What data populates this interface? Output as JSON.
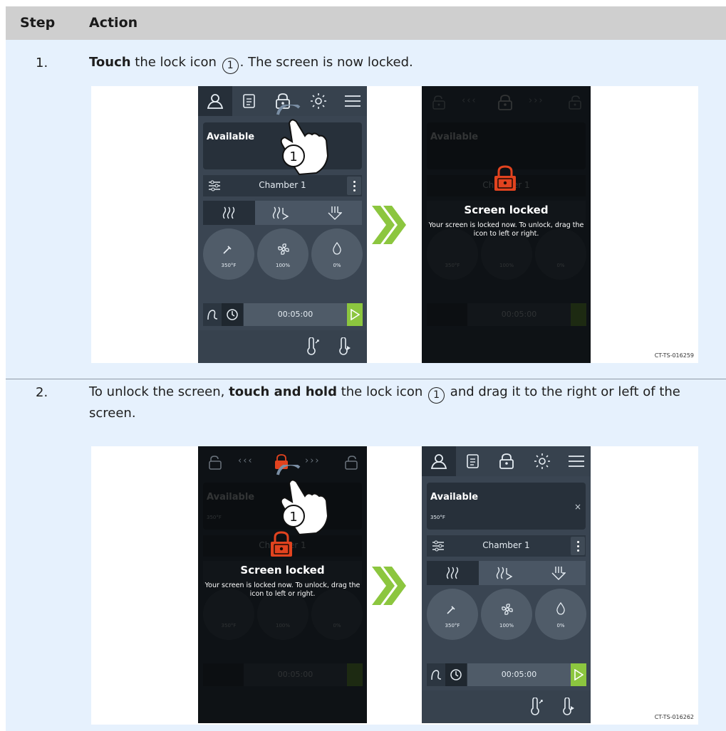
{
  "table": {
    "col_step": "Step",
    "col_action": "Action"
  },
  "steps": [
    {
      "number": "1.",
      "pre_bold": "Touch",
      "text_a": " the lock icon ",
      "callout": "1",
      "text_b": ". The screen is now locked.",
      "figure_ref": "CT-TS-016259"
    },
    {
      "number": "2.",
      "text_a": "To unlock the screen, ",
      "bold": "touch and hold",
      "text_b": " the lock icon ",
      "callout": "1",
      "text_c": " and drag it to the right or left of the screen.",
      "figure_ref": "CT-TS-016262"
    }
  ],
  "screen": {
    "status": "Available",
    "chamber": "Chamber 1",
    "temp": "350°F",
    "temp_small": "350°F",
    "fan": "100%",
    "humidity": "0%",
    "timer": "00:05:00",
    "lock_title": "Screen locked",
    "lock_msg_1": "Your screen is locked now. To unlock, drag the",
    "lock_msg_2": "icon to left or right.",
    "chev_left": "‹‹‹",
    "chev_right": "›››"
  },
  "colors": {
    "header_bg": "#cfcfcf",
    "row_bg": "#e6f1fd",
    "screen_bg": "#3a4552",
    "play_green": "#8cc63f",
    "arrow_green": "#8cc63f",
    "lock_red": "#e2431f"
  },
  "icons": [
    "user-icon",
    "clipboard-icon",
    "lock-icon",
    "sun-icon",
    "menu-icon",
    "settings-sliders-icon",
    "heat-waves-icon",
    "steam-icon",
    "probe-icon",
    "fan-icon",
    "drop-icon",
    "core-probe-icon",
    "clock-icon",
    "play-icon",
    "thermometer-icon",
    "hand-pointer-icon",
    "chevron-double-right-icon"
  ]
}
